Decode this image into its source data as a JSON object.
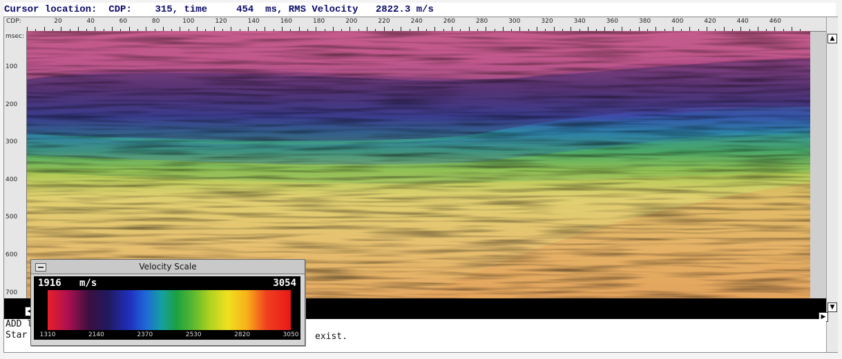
{
  "status": {
    "cursor_label": "Cursor location:",
    "cdp_label": "CDP:",
    "cdp_value": "315",
    "time_label": ", time",
    "time_value": "454",
    "time_unit": "ms,",
    "rms_label": "RMS Velocity",
    "rms_value": "2822.3",
    "rms_unit": "m/s"
  },
  "cdp_axis": {
    "label": "CDP:",
    "ticks": [
      "20",
      "40",
      "60",
      "80",
      "100",
      "120",
      "140",
      "160",
      "180",
      "200",
      "220",
      "240",
      "260",
      "280",
      "300",
      "320",
      "340",
      "360",
      "380",
      "400",
      "420",
      "440",
      "460"
    ]
  },
  "time_axis": {
    "unit_label": "msec:",
    "ticks": [
      "100",
      "200",
      "300",
      "400",
      "500",
      "600",
      "700"
    ]
  },
  "messages": {
    "line1": "ADD l",
    "line2": "Star",
    "line2_tail": "exist."
  },
  "velocity_scale": {
    "title": "Velocity Scale",
    "min": "1916",
    "unit": "m/s",
    "max": "3054",
    "ticks": [
      "1310",
      "2140",
      "2370",
      "2530",
      "2820",
      "3050"
    ]
  },
  "colors": {
    "status_text": "#0a0a6a",
    "low_velocity": "#e8202a",
    "high_velocity": "#f04020"
  },
  "icons": [
    "scroll-up-icon",
    "scroll-down-icon",
    "scroll-right-icon",
    "scroll-left-icon",
    "window-menu-icon"
  ]
}
